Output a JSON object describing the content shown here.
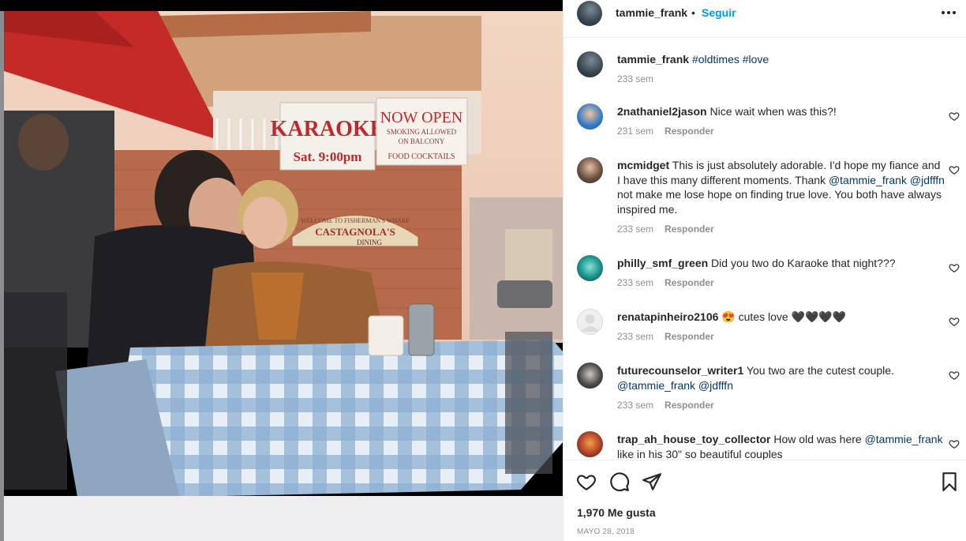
{
  "post": {
    "author": "tammie_frank",
    "dot": "•",
    "follow_label": "Seguir",
    "more_icon": "more-horizontal-icon"
  },
  "photo": {
    "signs": {
      "karaoke": "KARAOKE",
      "time": "Sat. 9:00pm",
      "now_open": "NOW OPEN",
      "smoking": "SMOKING ALLOWED",
      "balcony": "ON BALCONY",
      "food": "FOOD COCKTAILS",
      "welcome": "WELCOME TO FISHERMAN'S WHARF",
      "castagnola": "CASTAGNOLA'S",
      "dining": "DINING"
    }
  },
  "caption": {
    "username": "tammie_frank",
    "tag1": "#oldtimes",
    "tag2": "#love",
    "time": "233 sem"
  },
  "comments": [
    {
      "username": "2nathaniel2jason",
      "text": "Nice wait when was this?!",
      "time": "231 sem",
      "reply": "Responder"
    },
    {
      "username": "mcmidget",
      "text_a": "This is just absolutely adorable. I'd hope my fiance and I have this many different moments. Thank",
      "mention1": "@tammie_frank",
      "mention2": "@jdfffn",
      "text_b": "not make me lose hope on finding true love. You both have always inspired me.",
      "time": "233 sem",
      "reply": "Responder"
    },
    {
      "username": "philly_smf_green",
      "text": "Did you two do Karaoke that night???",
      "time": "233 sem",
      "reply": "Responder"
    },
    {
      "username": "renatapinheiro2106",
      "text": "😍 cutes love 🖤🖤🖤🖤",
      "time": "233 sem",
      "reply": "Responder"
    },
    {
      "username": "futurecounselor_writer1",
      "text": "You two are the cutest couple.",
      "mention1": "@tammie_frank",
      "mention2": "@jdfffn",
      "time": "233 sem",
      "reply": "Responder"
    },
    {
      "username": "trap_ah_house_toy_collector",
      "text_a": "How old was here",
      "mention1": "@tammie_frank",
      "text_b": "like in his 30\" so beautiful couples"
    }
  ],
  "footer": {
    "likes": "1,970 Me gusta",
    "date": "MAYO 28, 2018"
  },
  "colors": {
    "link_blue": "#0095f6",
    "mention": "#00376b",
    "meta_gray": "#8e8e8e",
    "text": "#262626"
  }
}
